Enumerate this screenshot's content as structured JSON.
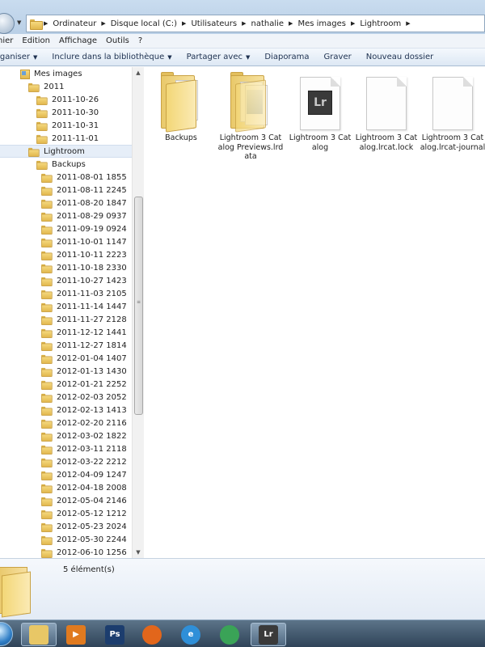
{
  "breadcrumb": {
    "items": [
      "Ordinateur",
      "Disque local (C:)",
      "Utilisateurs",
      "nathalie",
      "Mes images",
      "Lightroom"
    ]
  },
  "menubar": {
    "items": [
      "hier",
      "Edition",
      "Affichage",
      "Outils",
      "?"
    ]
  },
  "toolbar": {
    "organize": "rganiser",
    "include": "Inclure dans la bibliothèque",
    "share": "Partager avec",
    "slideshow": "Diaporama",
    "burn": "Graver",
    "new_folder": "Nouveau dossier"
  },
  "tree": {
    "items": [
      {
        "label": "Mes images",
        "indent": 1
      },
      {
        "label": "2011",
        "indent": 2
      },
      {
        "label": "2011-10-26",
        "indent": 3
      },
      {
        "label": "2011-10-30",
        "indent": 3
      },
      {
        "label": "2011-10-31",
        "indent": 3
      },
      {
        "label": "2011-11-01",
        "indent": 3
      },
      {
        "label": "Lightroom",
        "indent": 2,
        "selected": true
      },
      {
        "label": "Backups",
        "indent": 3
      },
      {
        "label": "2011-08-01 1855",
        "indent": 4
      },
      {
        "label": "2011-08-11 2245",
        "indent": 4
      },
      {
        "label": "2011-08-20 1847",
        "indent": 4
      },
      {
        "label": "2011-08-29 0937",
        "indent": 4
      },
      {
        "label": "2011-09-19 0924",
        "indent": 4
      },
      {
        "label": "2011-10-01 1147",
        "indent": 4
      },
      {
        "label": "2011-10-11 2223",
        "indent": 4
      },
      {
        "label": "2011-10-18 2330",
        "indent": 4
      },
      {
        "label": "2011-10-27 1423",
        "indent": 4
      },
      {
        "label": "2011-11-03 2105",
        "indent": 4
      },
      {
        "label": "2011-11-14 1447",
        "indent": 4
      },
      {
        "label": "2011-11-27 2128",
        "indent": 4
      },
      {
        "label": "2011-12-12 1441",
        "indent": 4
      },
      {
        "label": "2011-12-27 1814",
        "indent": 4
      },
      {
        "label": "2012-01-04 1407",
        "indent": 4
      },
      {
        "label": "2012-01-13 1430",
        "indent": 4
      },
      {
        "label": "2012-01-21 2252",
        "indent": 4
      },
      {
        "label": "2012-02-03 2052",
        "indent": 4
      },
      {
        "label": "2012-02-13 1413",
        "indent": 4
      },
      {
        "label": "2012-02-20 2116",
        "indent": 4
      },
      {
        "label": "2012-03-02 1822",
        "indent": 4
      },
      {
        "label": "2012-03-11 2118",
        "indent": 4
      },
      {
        "label": "2012-03-22 2212",
        "indent": 4
      },
      {
        "label": "2012-04-09 1247",
        "indent": 4
      },
      {
        "label": "2012-04-18 2008",
        "indent": 4
      },
      {
        "label": "2012-05-04 2146",
        "indent": 4
      },
      {
        "label": "2012-05-12 1212",
        "indent": 4
      },
      {
        "label": "2012-05-23 2024",
        "indent": 4
      },
      {
        "label": "2012-05-30 2244",
        "indent": 4
      },
      {
        "label": "2012-06-10 1256",
        "indent": 4
      }
    ]
  },
  "files": [
    {
      "name": "Backups",
      "type": "folder"
    },
    {
      "name": "Lightroom 3 Catalog Previews.lrdata",
      "type": "folder-docs"
    },
    {
      "name": "Lightroom 3 Catalog",
      "type": "lr-catalog",
      "badge": "Lr"
    },
    {
      "name": "Lightroom 3 Catalog.lrcat.lock",
      "type": "file"
    },
    {
      "name": "Lightroom 3 Catalog.lrcat-journal",
      "type": "file"
    }
  ],
  "details": {
    "count": "5 élément(s)"
  },
  "taskbar": {
    "apps": [
      {
        "name": "explorer",
        "label": "",
        "color": "#e8c766",
        "active": true
      },
      {
        "name": "media-player",
        "label": "▶",
        "color": "#e07a1f"
      },
      {
        "name": "photoshop",
        "label": "Ps",
        "color": "#1c3d6e"
      },
      {
        "name": "firefox",
        "label": "",
        "color": "#e2661b"
      },
      {
        "name": "internet-explorer",
        "label": "e",
        "color": "#2f8fd8"
      },
      {
        "name": "chrome",
        "label": "",
        "color": "#3aa357"
      },
      {
        "name": "lightroom",
        "label": "Lr",
        "color": "#3a3a3a",
        "active": true
      }
    ]
  }
}
